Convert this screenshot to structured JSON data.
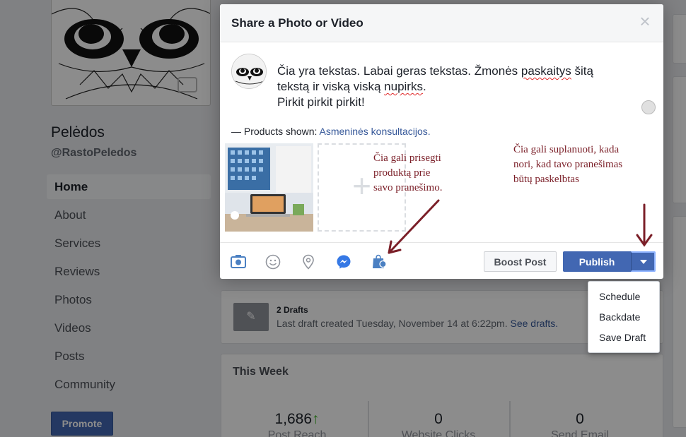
{
  "page": {
    "name": "Pelėdos",
    "handle": "@RastoPeledos",
    "nav": [
      "Home",
      "About",
      "Services",
      "Reviews",
      "Photos",
      "Videos",
      "Posts",
      "Community"
    ],
    "promote_label": "Promote"
  },
  "modal": {
    "title": "Share a Photo or Video",
    "close_label": "×",
    "text_line1_a": "Čia yra tekstas. Labai geras tekstas. Žmonės ",
    "text_line1_b": "paskaitys",
    "text_line1_c": " šitą",
    "text_line2_a": "tekstą ir viską viską ",
    "text_line2_b": "nupirks",
    "text_line2_c": ".",
    "text_line3": "Pirkit pirkit pirkit!",
    "products_prefix": "— Products shown: ",
    "products_link": "Asmeninės konsultacijos.",
    "add_label": "+",
    "boost_label": "Boost Post",
    "publish_label": "Publish"
  },
  "publish_menu": [
    "Schedule",
    "Backdate",
    "Save Draft"
  ],
  "drafts": {
    "title": "2 Drafts",
    "subtitle": "Last draft created Tuesday, November 14 at 6:22pm.",
    "link": "See drafts."
  },
  "this_week": {
    "title": "This Week",
    "stats": [
      {
        "value": "1,686",
        "trend": "↑",
        "label": "Post Reach"
      },
      {
        "value": "0",
        "trend": "",
        "label": "Website Clicks"
      },
      {
        "value": "0",
        "trend": "",
        "label": "Send Email"
      }
    ]
  },
  "annotations": {
    "left": "Čia gali prisegti\nproduktą prie\nsavo pranešimo.",
    "right": "Čia gali suplanuoti, kada\nnori, kad tavo pranešimas\nbūtų paskelbtas",
    "color": "#7b1f28"
  },
  "colors": {
    "primary": "#4267b2",
    "link": "#365899"
  },
  "icons": [
    "camera-icon",
    "smiley-icon",
    "location-pin-icon",
    "messenger-icon",
    "product-bag-icon"
  ]
}
